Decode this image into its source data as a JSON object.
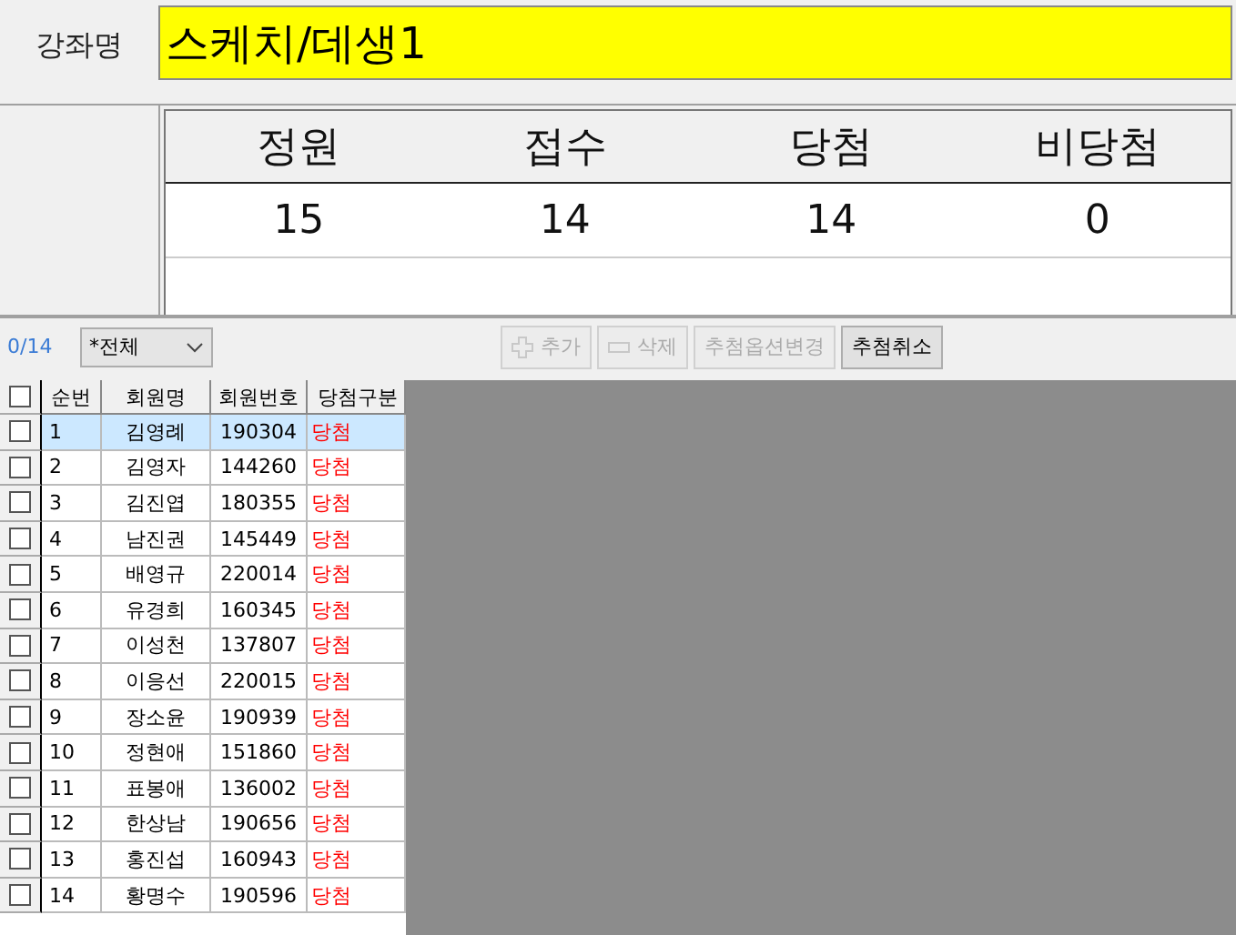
{
  "course": {
    "label": "강좌명",
    "value": "스케치/데생1"
  },
  "stats": [
    {
      "header": "정원",
      "value": "15"
    },
    {
      "header": "접수",
      "value": "14"
    },
    {
      "header": "당첨",
      "value": "14"
    },
    {
      "header": "비당첨",
      "value": "0"
    }
  ],
  "toolbar": {
    "count": "0/14",
    "filter": {
      "value": "*전체"
    },
    "buttons": [
      {
        "label": "추가",
        "kind": "add",
        "disabled": true
      },
      {
        "label": "삭제",
        "kind": "remove",
        "disabled": true
      },
      {
        "label": "추첨옵션변경",
        "kind": "text",
        "disabled": true
      },
      {
        "label": "추첨취소",
        "kind": "text",
        "disabled": false
      }
    ]
  },
  "grid": {
    "header_checked": false,
    "columns": [
      "순번",
      "회원명",
      "회원번호",
      "당첨구분"
    ],
    "rows": [
      {
        "no": "1",
        "name": "김영례",
        "member_no": "190304",
        "result": "당첨",
        "checked": false,
        "selected": true
      },
      {
        "no": "2",
        "name": "김영자",
        "member_no": "144260",
        "result": "당첨",
        "checked": false,
        "selected": false
      },
      {
        "no": "3",
        "name": "김진엽",
        "member_no": "180355",
        "result": "당첨",
        "checked": false,
        "selected": false
      },
      {
        "no": "4",
        "name": "남진권",
        "member_no": "145449",
        "result": "당첨",
        "checked": false,
        "selected": false
      },
      {
        "no": "5",
        "name": "배영규",
        "member_no": "220014",
        "result": "당첨",
        "checked": false,
        "selected": false
      },
      {
        "no": "6",
        "name": "유경희",
        "member_no": "160345",
        "result": "당첨",
        "checked": false,
        "selected": false
      },
      {
        "no": "7",
        "name": "이성천",
        "member_no": "137807",
        "result": "당첨",
        "checked": false,
        "selected": false
      },
      {
        "no": "8",
        "name": "이응선",
        "member_no": "220015",
        "result": "당첨",
        "checked": false,
        "selected": false
      },
      {
        "no": "9",
        "name": "장소윤",
        "member_no": "190939",
        "result": "당첨",
        "checked": false,
        "selected": false
      },
      {
        "no": "10",
        "name": "정현애",
        "member_no": "151860",
        "result": "당첨",
        "checked": false,
        "selected": false
      },
      {
        "no": "11",
        "name": "표봉애",
        "member_no": "136002",
        "result": "당첨",
        "checked": false,
        "selected": false
      },
      {
        "no": "12",
        "name": "한상남",
        "member_no": "190656",
        "result": "당첨",
        "checked": false,
        "selected": false
      },
      {
        "no": "13",
        "name": "홍진섭",
        "member_no": "160943",
        "result": "당첨",
        "checked": false,
        "selected": false
      },
      {
        "no": "14",
        "name": "황명수",
        "member_no": "190596",
        "result": "당첨",
        "checked": false,
        "selected": false
      }
    ]
  }
}
